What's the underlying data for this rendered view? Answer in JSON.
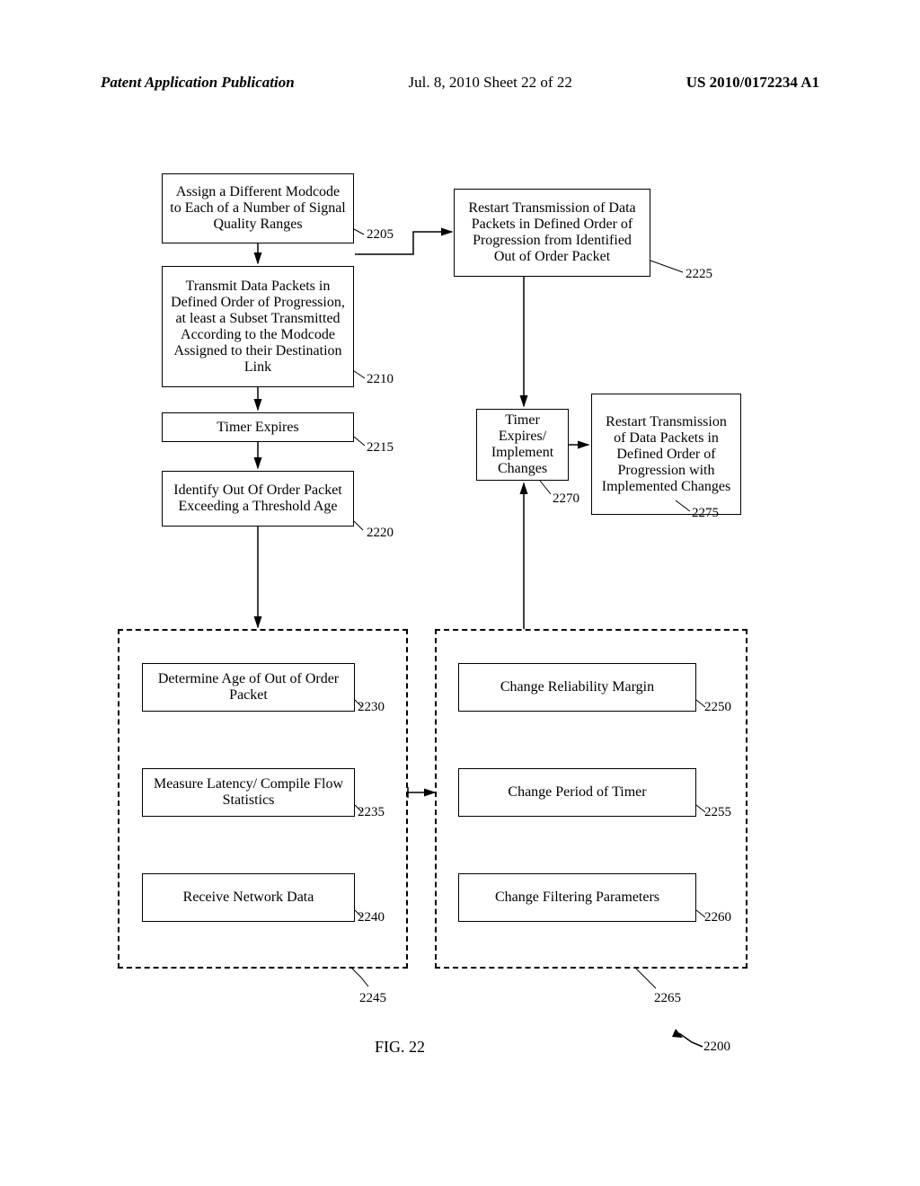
{
  "header": {
    "left": "Patent Application Publication",
    "center": "Jul. 8, 2010  Sheet 22 of 22",
    "right": "US 2010/0172234 A1"
  },
  "boxes": {
    "b2205": "Assign a Different Modcode to Each of a Number of Signal Quality Ranges",
    "b2210": "Transmit Data Packets in Defined Order of Progression, at least a Subset Transmitted According to the Modcode Assigned to their Destination Link",
    "b2215": "Timer Expires",
    "b2220": "Identify Out Of Order Packet Exceeding a Threshold Age",
    "b2225": "Restart Transmission of Data Packets in Defined Order of Progression from Identified Out of Order Packet",
    "b2270": "Timer Expires/ Implement Changes",
    "b2275": "Restart Transmission of Data Packets in Defined Order of Progression with Implemented Changes",
    "b2230": "Determine Age of Out of Order Packet",
    "b2235": "Measure Latency/ Compile Flow Statistics",
    "b2240": "Receive Network Data",
    "b2250": "Change Reliability Margin",
    "b2255": "Change Period of Timer",
    "b2260": "Change Filtering Parameters"
  },
  "refs": {
    "r2205": "2205",
    "r2210": "2210",
    "r2215": "2215",
    "r2220": "2220",
    "r2225": "2225",
    "r2230": "2230",
    "r2235": "2235",
    "r2240": "2240",
    "r2245": "2245",
    "r2250": "2250",
    "r2255": "2255",
    "r2260": "2260",
    "r2265": "2265",
    "r2270": "2270",
    "r2275": "2275",
    "r2200": "2200"
  },
  "figure_label": "FIG.  22"
}
